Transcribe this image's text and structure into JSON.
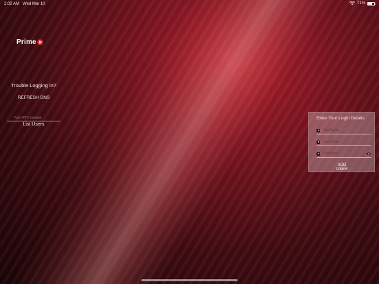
{
  "status_bar": {
    "time": "2:02 AM",
    "date": "Wed Mar 10",
    "battery": "71%",
    "battery_level": 0.71,
    "wifi_icon": "wifi-icon",
    "battery_icon": "battery-icon"
  },
  "logo": {
    "text": "Prime",
    "mark_icon": "play-triangle-icon",
    "mark_color": "#e2313c"
  },
  "left_panel": {
    "trouble_text": "Trouble Logging in?",
    "refresh_label": "REFRESH DNS",
    "iptv_placeholder": "Your IPTV domain",
    "iptv_value": "",
    "list_users_label": "List Users"
  },
  "login": {
    "title": "Enter Your Login Details",
    "fields": [
      {
        "icon": "user-icon",
        "placeholder": "Any Name",
        "value": ""
      },
      {
        "icon": "user-icon",
        "placeholder": "Username",
        "value": ""
      },
      {
        "icon": "lock-icon",
        "placeholder": "Password",
        "value": ""
      }
    ],
    "show_password_icon": "eye-icon",
    "add_user_label": "ADD USER"
  },
  "colors": {
    "background_dark": "#1a0406",
    "background_red": "#b3202c",
    "card_tint": "#cdb4b9"
  }
}
